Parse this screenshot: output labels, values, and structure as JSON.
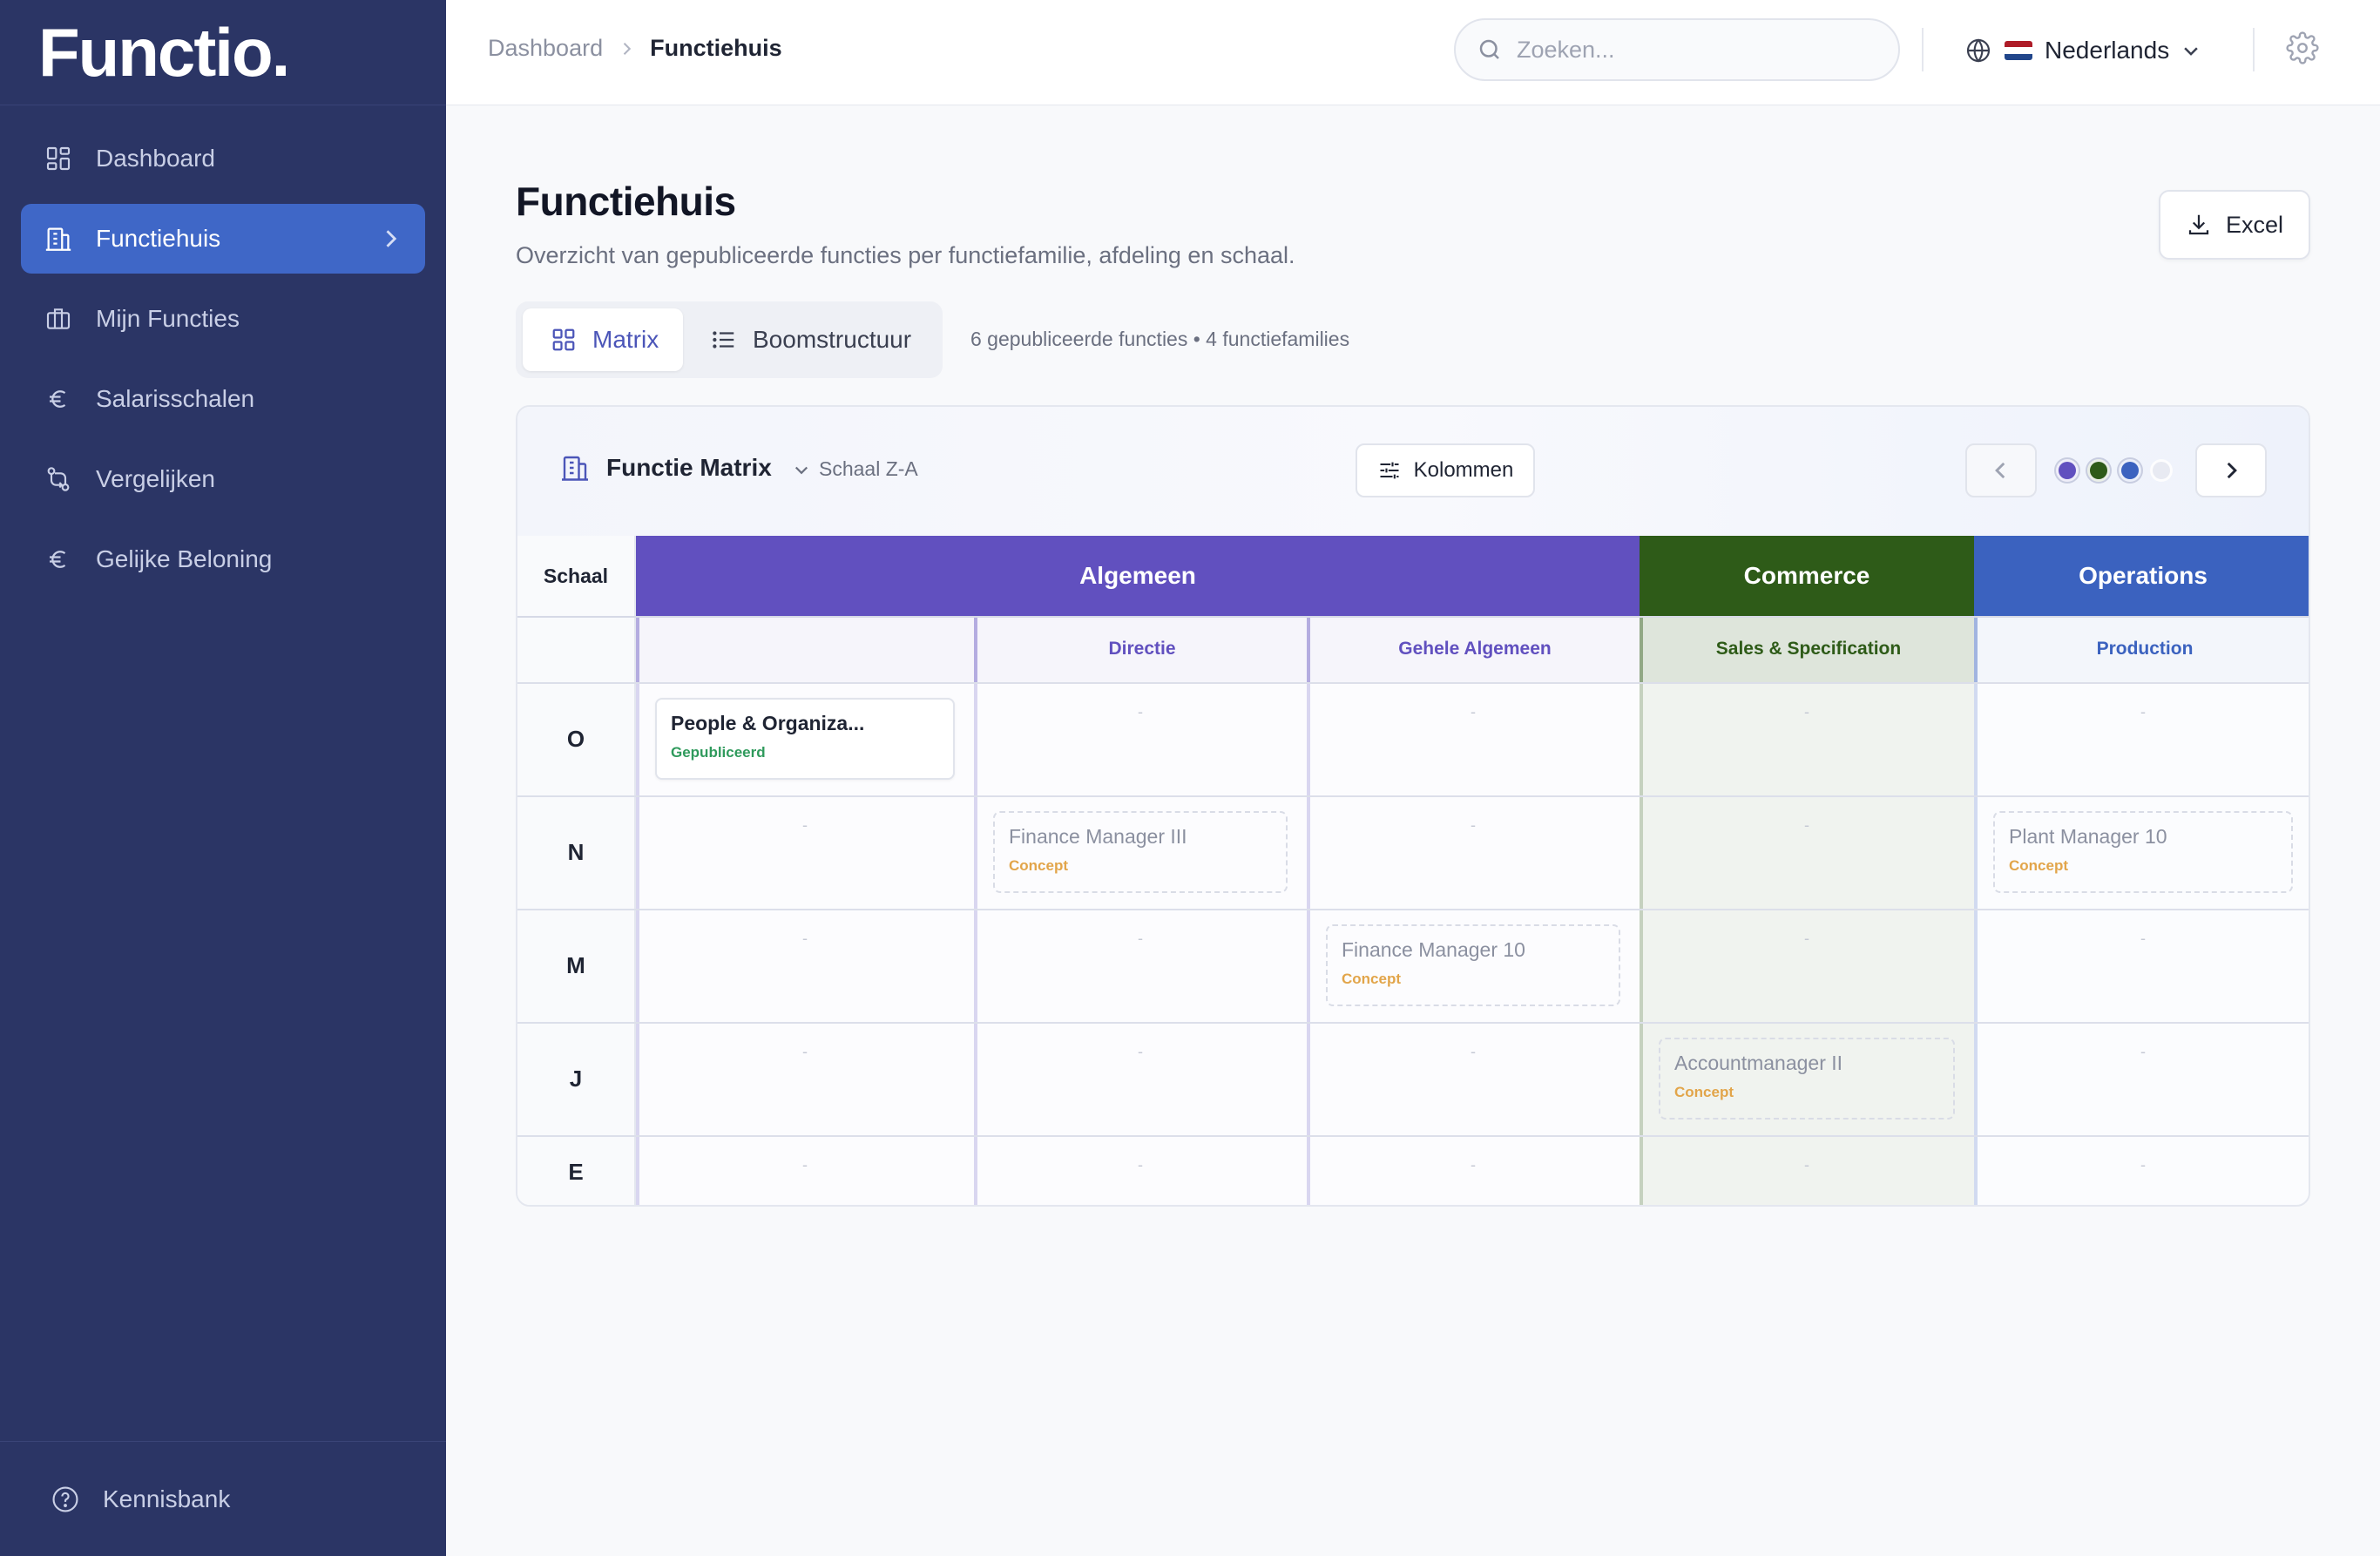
{
  "app": {
    "logo": "Functio."
  },
  "sidebar": {
    "items": [
      {
        "label": "Dashboard",
        "icon": "dashboard-icon"
      },
      {
        "label": "Functiehuis",
        "icon": "building-icon",
        "active": true
      },
      {
        "label": "Mijn Functies",
        "icon": "briefcase-icon"
      },
      {
        "label": "Salarisschalen",
        "icon": "euro-icon"
      },
      {
        "label": "Vergelijken",
        "icon": "compare-icon"
      },
      {
        "label": "Gelijke Beloning",
        "icon": "euro-icon"
      }
    ],
    "footer": {
      "label": "Kennisbank",
      "icon": "help-icon"
    }
  },
  "topbar": {
    "breadcrumb": {
      "root": "Dashboard",
      "current": "Functiehuis"
    },
    "search": {
      "placeholder": "Zoeken..."
    },
    "language": {
      "label": "Nederlands",
      "flag": "nl-flag"
    }
  },
  "page": {
    "title": "Functiehuis",
    "subtitle": "Overzicht van gepubliceerde functies per functiefamilie, afdeling en schaal.",
    "export_label": "Excel",
    "view_tabs": {
      "matrix": "Matrix",
      "tree": "Boomstructuur",
      "active": "matrix"
    },
    "summary": "6 gepubliceerde functies • 4 functiefamilies"
  },
  "matrix": {
    "title": "Functie Matrix",
    "sort_label": "Schaal Z-A",
    "columns_label": "Kolommen",
    "scale_header": "Schaal",
    "families": [
      {
        "name": "Algemeen",
        "color": "#6150bf"
      },
      {
        "name": "Commerce",
        "color": "#2e5b18"
      },
      {
        "name": "Operations",
        "color": "#3b62bf"
      }
    ],
    "departments": [
      {
        "name": "",
        "family": "Algemeen"
      },
      {
        "name": "Directie",
        "family": "Algemeen"
      },
      {
        "name": "Gehele Algemeen",
        "family": "Algemeen"
      },
      {
        "name": "Sales & Specification",
        "family": "Commerce"
      },
      {
        "name": "Production",
        "family": "Operations"
      }
    ],
    "pagination_dots": [
      "#6150bf",
      "#2e5b18",
      "#3b62bf",
      "#e8eaf2"
    ],
    "rows": [
      "O",
      "N",
      "M",
      "J",
      "E"
    ],
    "empty_marker": "-",
    "jobs": [
      {
        "title": "People & Organiza...",
        "status": "Gepubliceerd",
        "row": "O",
        "dept": 0,
        "published": true
      },
      {
        "title": "Finance Manager III",
        "status": "Concept",
        "row": "N",
        "dept": 1,
        "published": false
      },
      {
        "title": "Plant Manager 10",
        "status": "Concept",
        "row": "N",
        "dept": 4,
        "published": false
      },
      {
        "title": "Finance Manager 10",
        "status": "Concept",
        "row": "M",
        "dept": 2,
        "published": false
      },
      {
        "title": "Accountmanager II",
        "status": "Concept",
        "row": "J",
        "dept": 3,
        "published": false
      }
    ]
  }
}
